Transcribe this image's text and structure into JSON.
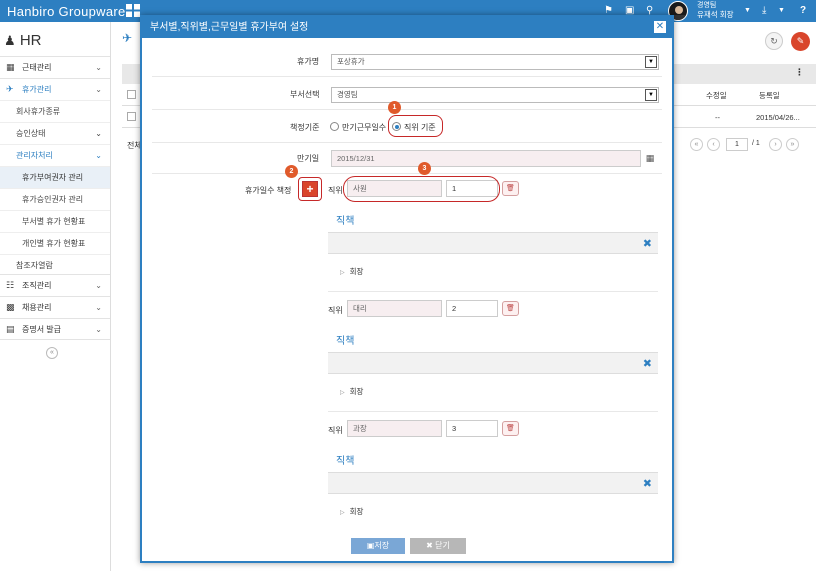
{
  "topbar": {
    "brand": "Hanbiro Groupware",
    "user_name": "경영팀",
    "user_title": "유재석 회장",
    "bg_color": "#2d7fc1"
  },
  "sidebar": {
    "module_title": "HR",
    "items": [
      {
        "label": "근태관리",
        "icon": "building-icon"
      },
      {
        "label": "휴가관리",
        "icon": "plane-icon"
      },
      {
        "label": "조직관리",
        "icon": "org-chart-icon"
      },
      {
        "label": "채용관리",
        "icon": "office-icon"
      },
      {
        "label": "증명서 발급",
        "icon": "certificate-icon"
      }
    ],
    "subitems": [
      {
        "label": "회사휴가종류"
      },
      {
        "label": "승인상태"
      },
      {
        "label": "관리자처리"
      },
      {
        "label": "휴가부여권자 관리"
      },
      {
        "label": "휴가승인권자 관리"
      },
      {
        "label": "부서별 휴가 현황표"
      },
      {
        "label": "개인별 휴가 현황표"
      },
      {
        "label": "참조자열람"
      }
    ]
  },
  "background_list": {
    "total_label": "전체",
    "col_modified": "수정일",
    "col_registered": "등록일",
    "row_modified": "--",
    "row_registered": "2015/04/26...",
    "page_current": "1",
    "page_total": "/ 1"
  },
  "modal": {
    "title": "부서별,직위별,근무일별 휴가부여 설정",
    "vacation_name_label": "휴가명",
    "vacation_name_value": "포상휴가",
    "dept_label": "부서선택",
    "dept_value": "경영팀",
    "criteria_label": "책정기준",
    "criteria_opt1": "만기근무일수",
    "criteria_opt2": "직위 기준",
    "expiry_label": "만기일",
    "expiry_value": "2015/12/31",
    "days_label": "휴가일수 책정",
    "position_label": "직위",
    "duty_title": "직책",
    "duty_node": "회장",
    "rows": [
      {
        "position": "사원",
        "days": "1"
      },
      {
        "position": "대리",
        "days": "2"
      },
      {
        "position": "과장",
        "days": "3"
      }
    ],
    "save_label": "저장",
    "close_label": "닫기",
    "badges": [
      "1",
      "2",
      "3"
    ]
  }
}
